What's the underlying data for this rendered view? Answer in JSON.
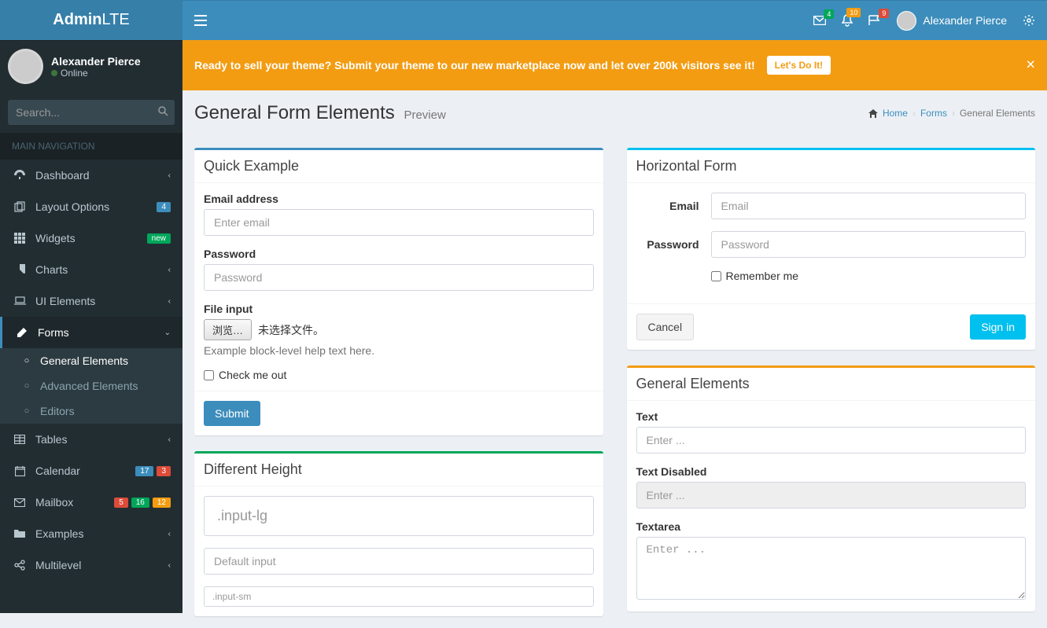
{
  "brand": {
    "bold": "Admin",
    "light": "LTE"
  },
  "navbar": {
    "messages_badge": "4",
    "notifications_badge": "10",
    "flags_badge": "9",
    "user_name": "Alexander Pierce"
  },
  "sidebar": {
    "user_name": "Alexander Pierce",
    "user_status": "Online",
    "search_placeholder": "Search...",
    "header": "MAIN NAVIGATION",
    "items": {
      "dashboard": "Dashboard",
      "layout": "Layout Options",
      "layout_badge": "4",
      "widgets": "Widgets",
      "widgets_badge": "new",
      "charts": "Charts",
      "ui": "UI Elements",
      "forms": "Forms",
      "forms_sub": {
        "general": "General Elements",
        "advanced": "Advanced Elements",
        "editors": "Editors"
      },
      "tables": "Tables",
      "calendar": "Calendar",
      "calendar_badge1": "17",
      "calendar_badge2": "3",
      "mailbox": "Mailbox",
      "mailbox_badge1": "5",
      "mailbox_badge2": "16",
      "mailbox_badge3": "12",
      "examples": "Examples",
      "multilevel": "Multilevel"
    }
  },
  "alert": {
    "text": "Ready to sell your theme? Submit your theme to our new marketplace now and let over 200k visitors see it!",
    "button": "Let's Do It!"
  },
  "page": {
    "title": "General Form Elements",
    "subtitle": "Preview",
    "breadcrumb": {
      "home": "Home",
      "forms": "Forms",
      "current": "General Elements"
    }
  },
  "boxes": {
    "quick": {
      "title": "Quick Example",
      "email_label": "Email address",
      "email_placeholder": "Enter email",
      "password_label": "Password",
      "password_placeholder": "Password",
      "file_label": "File input",
      "file_button": "浏览…",
      "file_status": "未选择文件。",
      "help": "Example block-level help text here.",
      "checkbox": "Check me out",
      "submit": "Submit"
    },
    "height": {
      "title": "Different Height",
      "lg_placeholder": ".input-lg",
      "md_placeholder": "Default input",
      "sm_placeholder": ".input-sm"
    },
    "horizontal": {
      "title": "Horizontal Form",
      "email_label": "Email",
      "email_placeholder": "Email",
      "password_label": "Password",
      "password_placeholder": "Password",
      "remember": "Remember me",
      "cancel": "Cancel",
      "signin": "Sign in"
    },
    "general": {
      "title": "General Elements",
      "text_label": "Text",
      "text_placeholder": "Enter ...",
      "disabled_label": "Text Disabled",
      "disabled_placeholder": "Enter ...",
      "textarea_label": "Textarea",
      "textarea_placeholder": "Enter ..."
    }
  }
}
